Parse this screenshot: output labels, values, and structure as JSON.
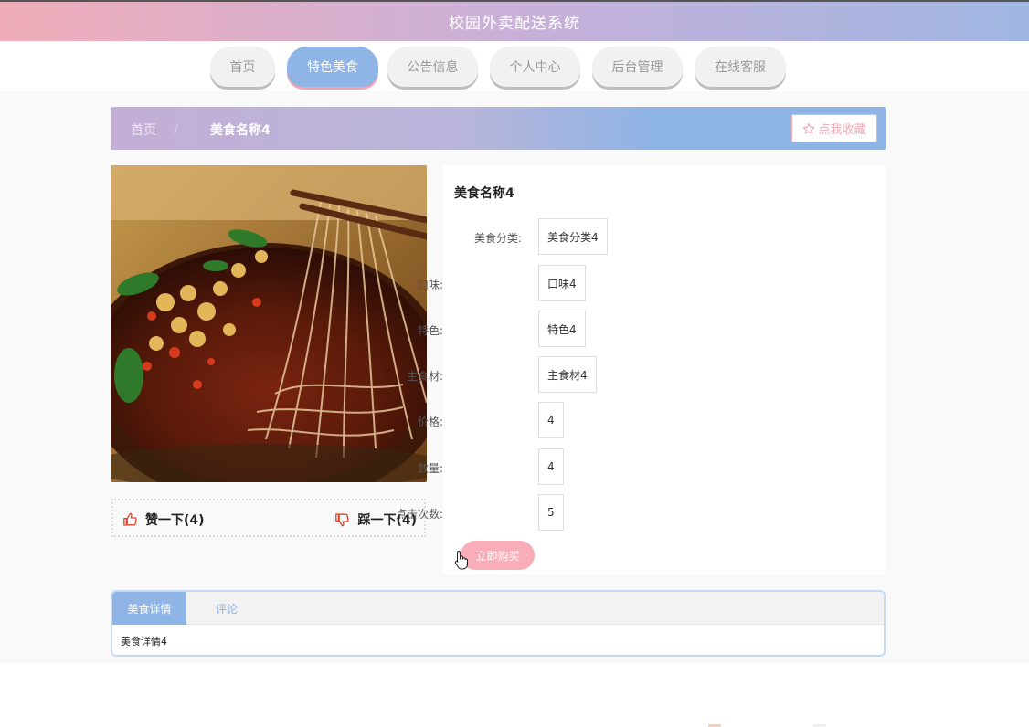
{
  "header": {
    "title": "校园外卖配送系统"
  },
  "nav": {
    "tabs": [
      {
        "label": "首页",
        "active": false
      },
      {
        "label": "特色美食",
        "active": true
      },
      {
        "label": "公告信息",
        "active": false
      },
      {
        "label": "个人中心",
        "active": false
      },
      {
        "label": "后台管理",
        "active": false
      },
      {
        "label": "在线客服",
        "active": false
      }
    ]
  },
  "breadcrumb": {
    "home": "首页",
    "separator": "/",
    "current": "美食名称4"
  },
  "favorite": {
    "label": "点我收藏",
    "icon": "star-outline-icon"
  },
  "food": {
    "name": "美食名称4",
    "image_icon": "food-photo",
    "fields": [
      {
        "label": "美食分类:",
        "value": "美食分类4"
      },
      {
        "label": "口味:",
        "value": "口味4"
      },
      {
        "label": "特色:",
        "value": "特色4"
      },
      {
        "label": "主食材:",
        "value": "主食材4"
      },
      {
        "label": "价格:",
        "value": "4"
      },
      {
        "label": "数量:",
        "value": "4"
      },
      {
        "label": "点击次数:",
        "value": "5"
      }
    ],
    "buy_label": "立即购买"
  },
  "votes": {
    "like_label": "赞一下(4)",
    "dislike_label": "踩一下(4)",
    "like_icon": "thumbs-up-icon",
    "dislike_icon": "thumbs-down-icon"
  },
  "detail": {
    "tabs": [
      {
        "label": "美食详情"
      },
      {
        "label": "评论"
      }
    ],
    "content": "美食详情4"
  },
  "colors": {
    "accent_blue": "#8fb4e6",
    "accent_pink": "#f8adb9",
    "header_gradient_start": "#f0adb9",
    "header_gradient_end": "#9fb6e2"
  }
}
